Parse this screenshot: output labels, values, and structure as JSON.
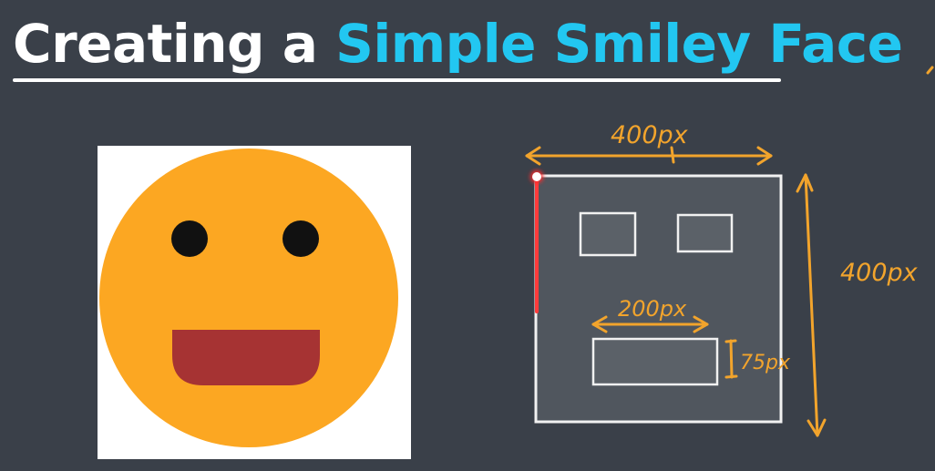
{
  "title": {
    "prefix": "Creating a",
    "highlight": "Simple Smiley Face"
  },
  "annotations": {
    "width_label": "400px",
    "height_label": "400px",
    "mouth_width_label": "200px",
    "mouth_height_label": "75px"
  },
  "colors": {
    "background": "#3a4049",
    "title_text": "#ffffff",
    "title_accent": "#22c7f1",
    "face": "#fca722",
    "eyes": "#111111",
    "mouth": "#a63333",
    "sketch_ink": "#f2a42c",
    "wireframe_fill": "#50565e",
    "wireframe_stroke": "#f1f1f1",
    "pointer_highlight": "#ff2a2a"
  },
  "icons": {
    "smiley": "smiley-face-icon"
  }
}
